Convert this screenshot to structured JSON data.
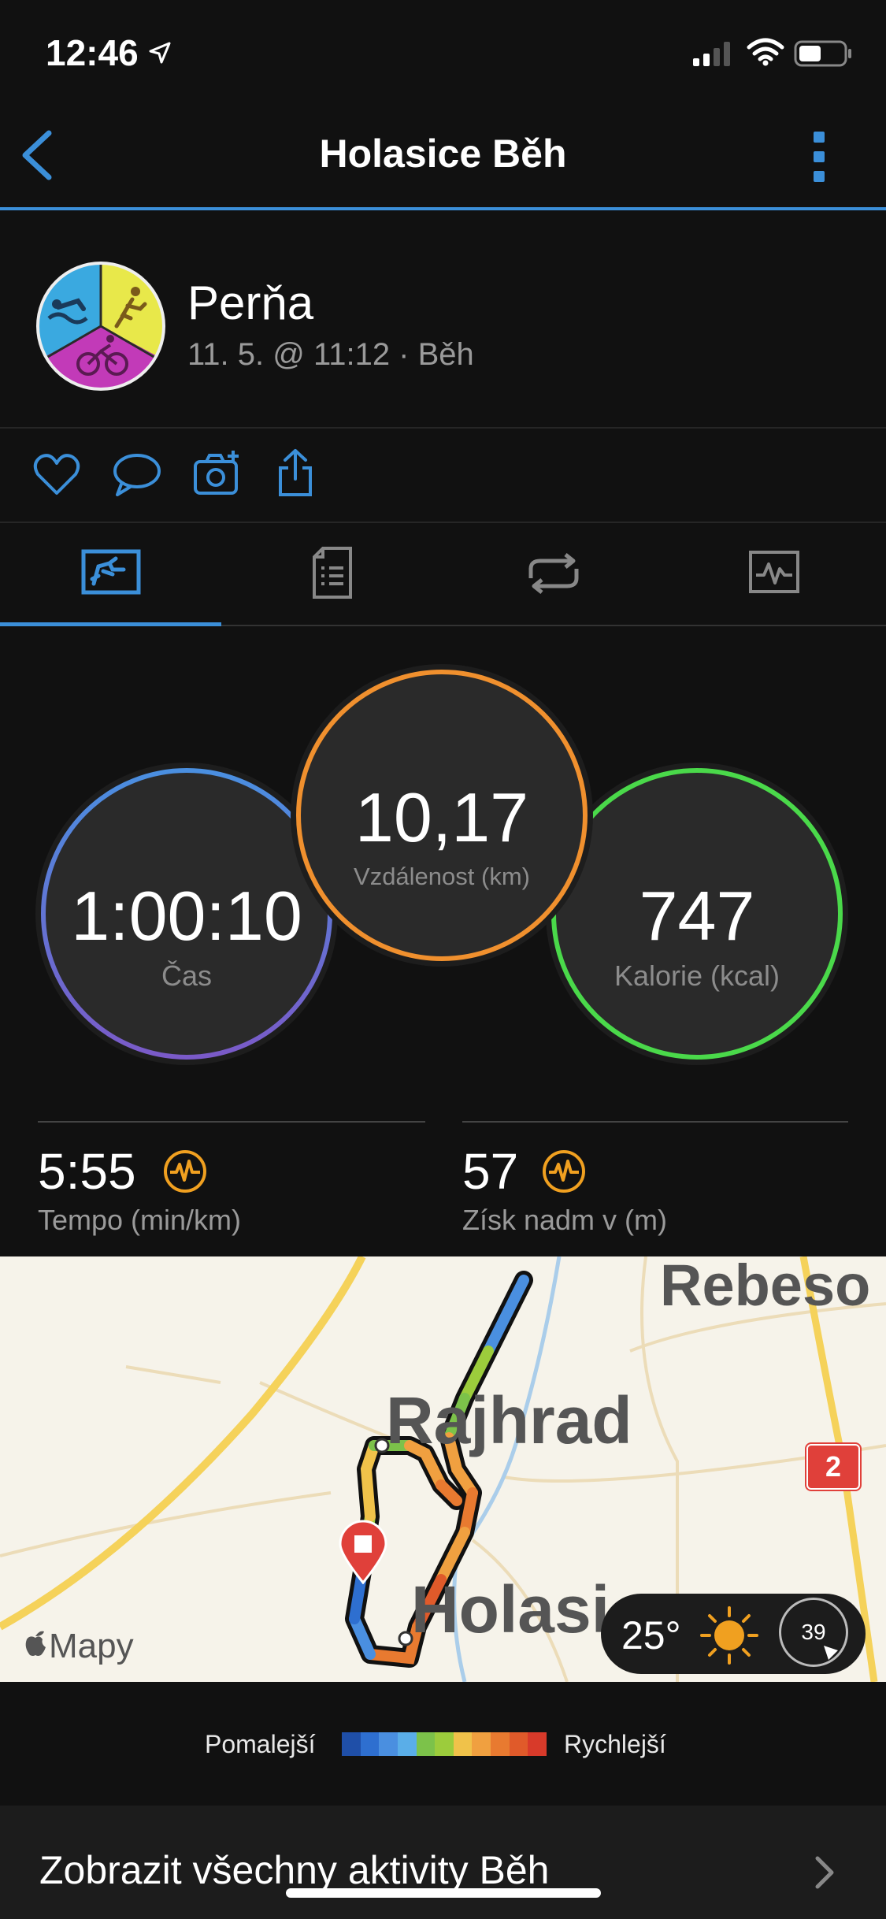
{
  "status_bar": {
    "time": "12:46"
  },
  "header": {
    "title": "Holasice Běh"
  },
  "activity": {
    "user_name": "Perňa",
    "meta": "11. 5. @ 11:12 · Běh"
  },
  "stats": {
    "time_value": "1:00:10",
    "time_label": "Čas",
    "distance_value": "10,17",
    "distance_label": "Vzdálenost (km)",
    "calories_value": "747",
    "calories_label": "Kalorie (kcal)"
  },
  "metrics": {
    "pace_value": "5:55",
    "pace_label": "Tempo (min/km)",
    "elevation_value": "57",
    "elevation_label": "Získ nadm v (m)"
  },
  "map": {
    "label_rebeso": "Rebeso",
    "label_rajhrad": "Rajhrad",
    "label_holasice": "Holasi",
    "road_badge": "2",
    "attribution": "Mapy",
    "weather_temp": "25°",
    "aqi": "39"
  },
  "legend": {
    "slower": "Pomalejší",
    "faster": "Rychlejší",
    "colors": [
      "#1f4fa8",
      "#2e6fd0",
      "#4a8fe0",
      "#5aaee8",
      "#7cc24a",
      "#9ccc3c",
      "#f0c24a",
      "#f0a040",
      "#e87a30",
      "#e05a2a",
      "#d83a2a"
    ]
  },
  "footer": {
    "link": "Zobrazit všechny aktivity Běh"
  },
  "colors": {
    "accent": "#3b8fd9",
    "time_ring": "#4a7fe0",
    "distance_ring": "#f0902e",
    "calories_ring": "#4ad94a",
    "icon_orange": "#f0a020"
  }
}
